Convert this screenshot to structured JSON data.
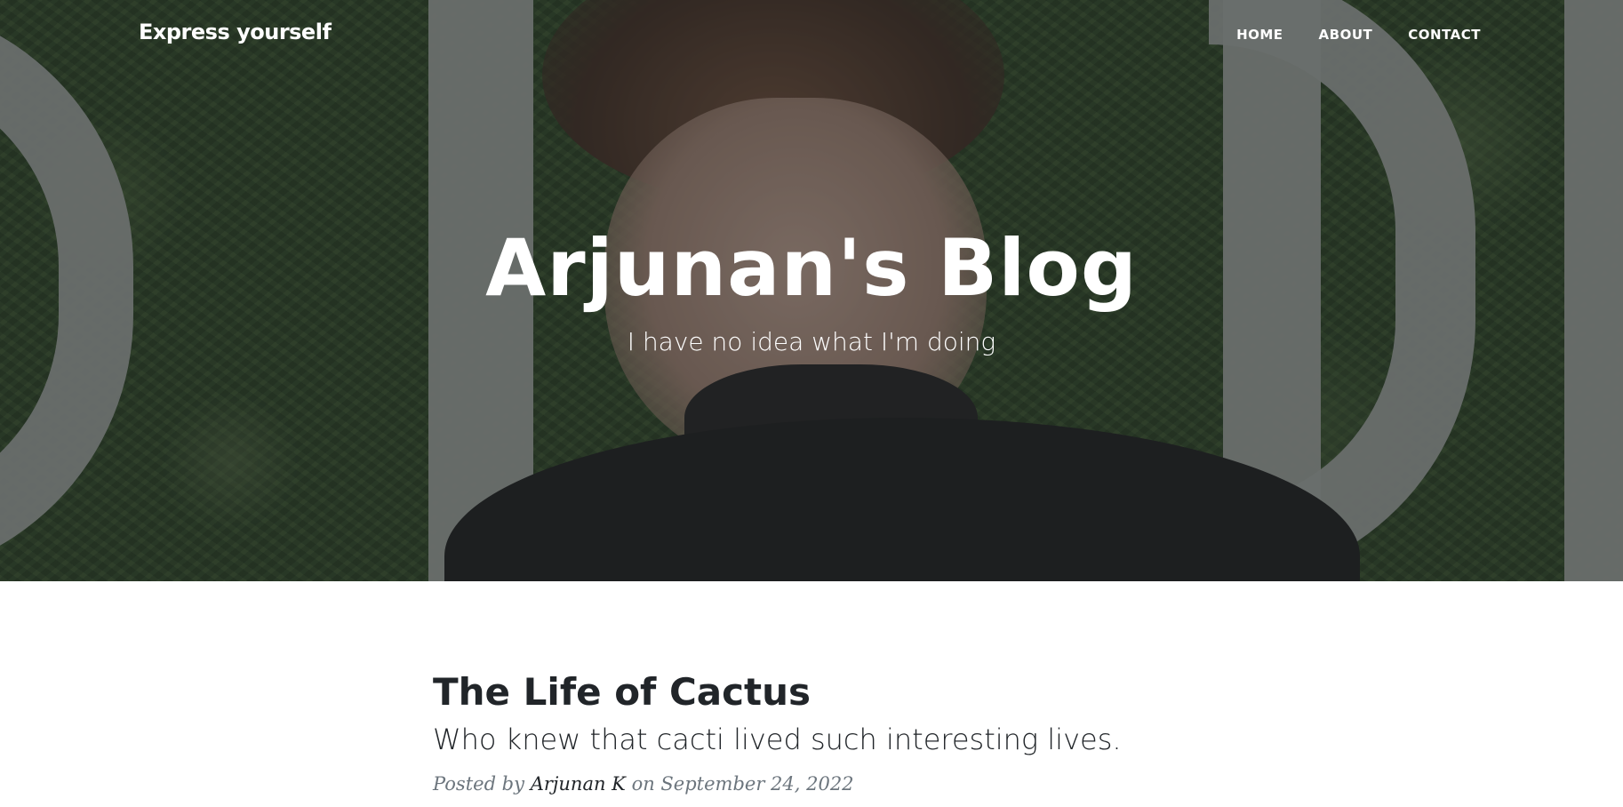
{
  "navbar": {
    "brand": "Express yourself",
    "links": [
      "HOME",
      "ABOUT",
      "CONTACT"
    ]
  },
  "header": {
    "title": "Arjunan's Blog",
    "subtitle": "I have no idea what I'm doing"
  },
  "post": {
    "title": "The Life of Cactus",
    "subtitle": "Who knew that cacti lived such interesting lives.",
    "meta_prefix": "Posted by",
    "author": "Arjunan K",
    "meta_on": "on September 24, 2022"
  },
  "colors": {
    "text_dark": "#212529",
    "text_muted": "#6c757d",
    "hero_overlay": "#212529",
    "nav_text": "#ffffff"
  }
}
